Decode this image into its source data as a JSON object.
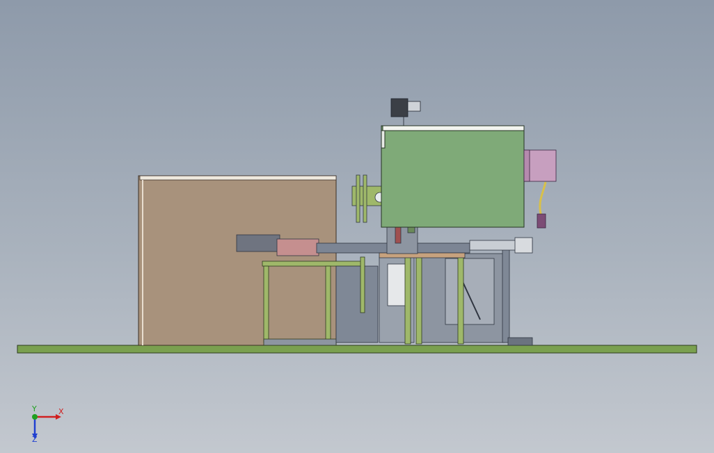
{
  "viewport": {
    "colors": {
      "background_top": "#8e9aaa",
      "background_bottom": "#c3c8cf",
      "base_plate": "#7aa04f",
      "cabinet": "#a8927c",
      "housing": "#7faa78",
      "motor": "#c79fbf",
      "steel": "#8d95a1",
      "frame_green": "#9fb86a"
    }
  },
  "triad": {
    "x_label": "X",
    "y_label": "Y",
    "z_label": "Z",
    "x_color": "#d02020",
    "y_color": "#20a020",
    "z_color": "#2040d0"
  }
}
